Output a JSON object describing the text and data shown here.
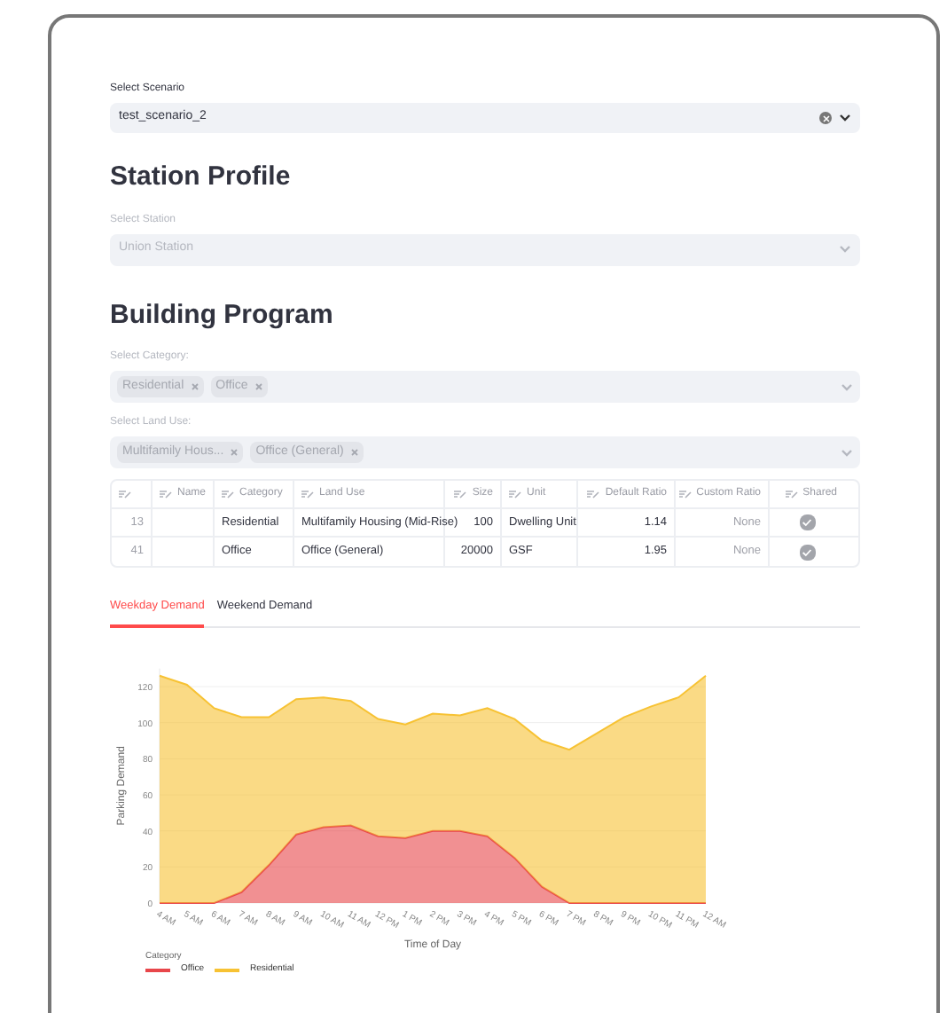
{
  "scenario_select": {
    "label": "Select Scenario",
    "value": "test_scenario_2"
  },
  "station_profile": {
    "heading": "Station Profile",
    "select": {
      "label": "Select Station",
      "value": "Union Station",
      "disabled": true
    }
  },
  "building_program": {
    "heading": "Building Program",
    "multiselects": [
      {
        "label": "Select Category:",
        "disabled": true,
        "tags": [
          "Residential",
          "Office"
        ]
      },
      {
        "label": "Select Land Use:",
        "disabled": true,
        "tags": [
          "Multifamily Hous...",
          "Office (General)"
        ]
      }
    ],
    "table": {
      "columns": [
        {},
        {
          "label": "Name"
        },
        {
          "label": "Category"
        },
        {
          "label": "Land Use"
        },
        {
          "label": "Size"
        },
        {
          "label": "Unit"
        },
        {
          "label": "Default Ratio"
        },
        {
          "label": "Custom Ratio"
        },
        {
          "label": "Shared"
        }
      ],
      "rows": [
        {
          "index": "13",
          "name": "",
          "category": "Residential",
          "land_use": "Multifamily Housing (Mid-Rise)",
          "size": "100",
          "unit": "Dwelling Unit",
          "default_ratio": "1.14",
          "custom_ratio": "None",
          "shared": true
        },
        {
          "index": "41",
          "name": "",
          "category": "Office",
          "land_use": "Office (General)",
          "size": "20000",
          "unit": "GSF",
          "default_ratio": "1.95",
          "custom_ratio": "None",
          "shared": true
        }
      ]
    }
  },
  "tabs": [
    {
      "label": "Weekday Demand",
      "selected": true
    },
    {
      "label": "Weekend Demand",
      "selected": false
    }
  ],
  "chart_data": {
    "type": "area",
    "stacked": true,
    "xlabel": "Time of Day",
    "ylabel": "Parking Demand",
    "legend": {
      "title": "Category"
    },
    "grid": true,
    "categories": [
      "4 AM",
      "5 AM",
      "6 AM",
      "7 AM",
      "8 AM",
      "9 AM",
      "10 AM",
      "11 AM",
      "12 PM",
      "1 PM",
      "2 PM",
      "3 PM",
      "4 PM",
      "5 PM",
      "6 PM",
      "7 PM",
      "8 PM",
      "9 PM",
      "10 PM",
      "11 PM",
      "12 AM"
    ],
    "ylim": [
      0,
      130
    ],
    "yticks": [
      0,
      20,
      40,
      60,
      80,
      100,
      120
    ],
    "series": [
      {
        "name": "Office",
        "color": "#e8464a",
        "values": [
          0,
          0,
          0,
          6,
          21,
          38,
          42,
          43,
          37,
          36,
          40,
          40,
          37,
          25,
          9,
          0,
          0,
          0,
          0,
          0,
          0
        ]
      },
      {
        "name": "Residential",
        "color": "#f7c233",
        "values": [
          126,
          121,
          108,
          97,
          82,
          75,
          72,
          69,
          65,
          63,
          65,
          64,
          71,
          77,
          81,
          85,
          94,
          103,
          109,
          114,
          126
        ]
      }
    ]
  }
}
